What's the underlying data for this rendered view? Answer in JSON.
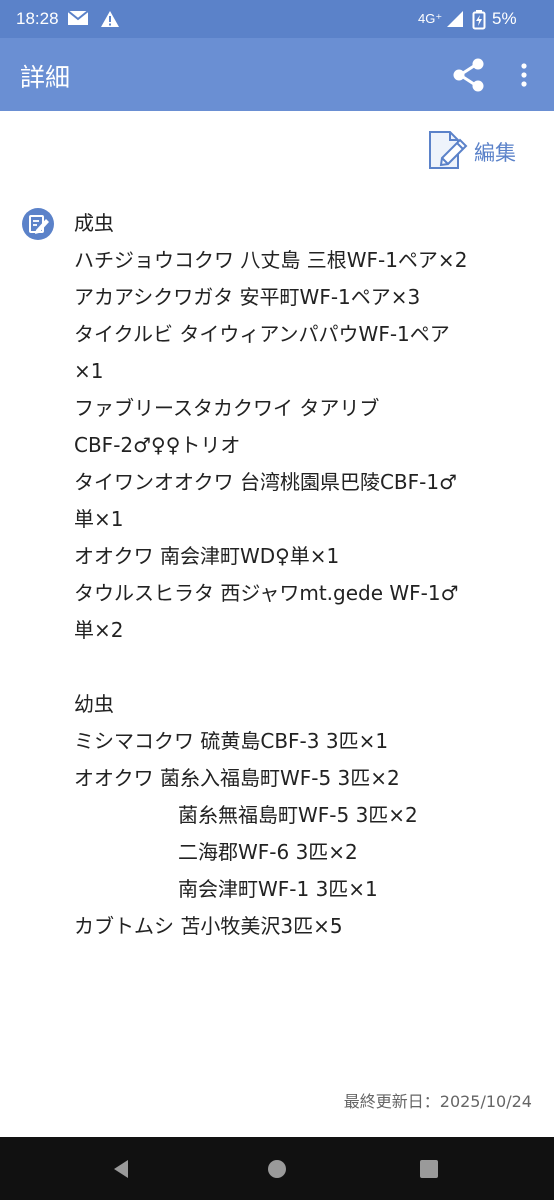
{
  "status_bar": {
    "time": "18:28",
    "network": "4G⁺",
    "battery": "5%",
    "icons": [
      "gmail-icon",
      "warning-icon",
      "signal-icon",
      "battery-icon"
    ]
  },
  "app_bar": {
    "title": "詳細",
    "icons": [
      "share-icon",
      "more-vert-icon"
    ]
  },
  "edit": {
    "label": "編集",
    "icon": "edit-note-icon"
  },
  "memo": {
    "icon": "memo-icon",
    "lines": [
      "成虫",
      "ハチジョウコクワ 八丈島 三根WF-1ペア×2",
      "アカアシクワガタ 安平町WF-1ペア×3",
      "タイクルビ タイウィアンパパウWF-1ペア",
      "×1",
      "ファブリースタカクワイ タアリブ",
      "CBF-2♂♀♀トリオ",
      "タイワンオオクワ 台湾桃園県巴陵CBF-1♂",
      "単×1",
      "オオクワ 南会津町WD♀単×1",
      "タウルスヒラタ 西ジャワmt.gede WF-1♂",
      "単×2",
      "",
      "幼虫",
      "ミシマコクワ 硫黄島CBF-3 3匹×1",
      "オオクワ 菌糸入福島町WF-5 3匹×2",
      "菌糸無福島町WF-5 3匹×2",
      "二海郡WF-6 3匹×2",
      "南会津町WF-1 3匹×1",
      "カブトムシ 苫小牧美沢3匹×5"
    ]
  },
  "footer": {
    "last_updated": "最終更新日：2025/10/24"
  },
  "nav_bar": {
    "icons": [
      "back-icon",
      "home-icon",
      "recents-icon"
    ]
  },
  "colors": {
    "status_bar": "#5b82c9",
    "app_bar": "#6a8fd3",
    "accent": "#5b82c9",
    "nav_bar": "#111111"
  }
}
